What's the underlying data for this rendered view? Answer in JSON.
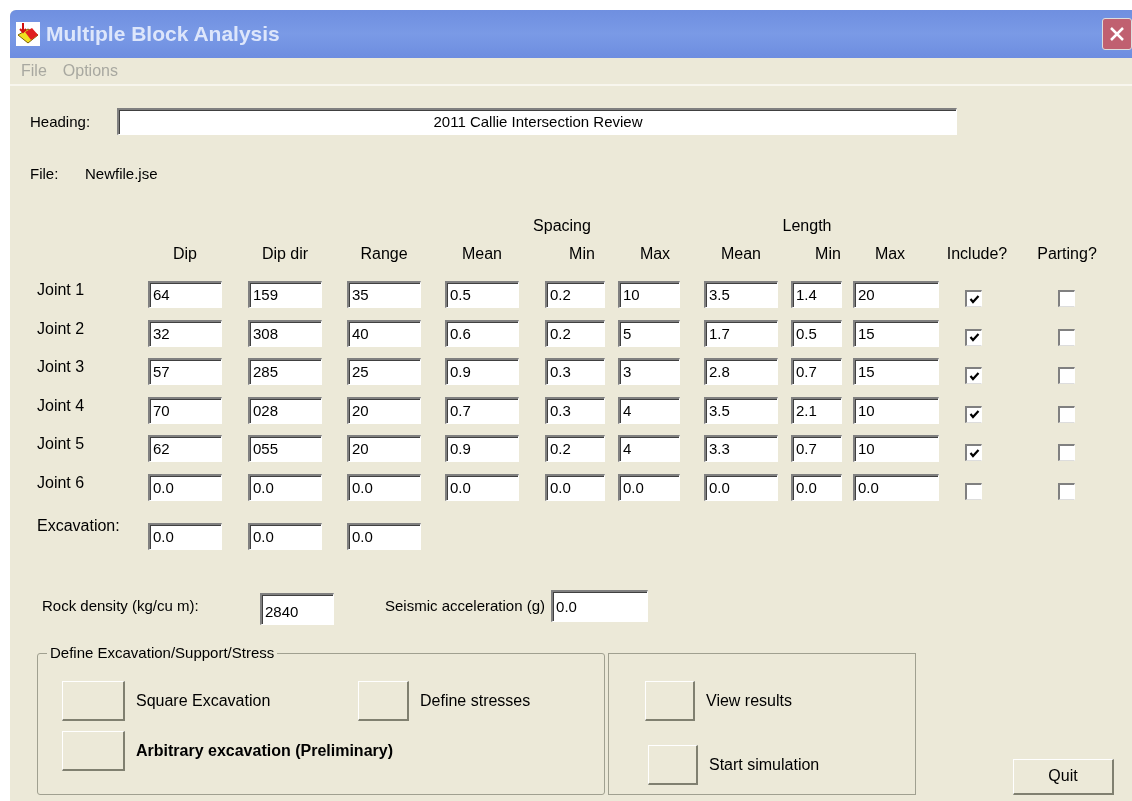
{
  "window": {
    "title": "Multiple Block Analysis"
  },
  "menu": [
    {
      "label": "File",
      "disabled": true
    },
    {
      "label": "Options",
      "disabled": true
    }
  ],
  "heading": {
    "label": "Heading:",
    "value": "2011 Callie Intersection Review"
  },
  "file": {
    "label": "File:",
    "value": "Newfile.jse"
  },
  "group_headers": [
    "Spacing",
    "Length"
  ],
  "columns": [
    "Dip",
    "Dip dir",
    "Range",
    "Mean",
    "Min",
    "Max",
    "Mean",
    "Min",
    "Max",
    "Include?",
    "Parting?"
  ],
  "joints": [
    {
      "label": "Joint 1",
      "values": [
        "64",
        "159",
        "35",
        "0.5",
        "0.2",
        "10",
        "3.5",
        "1.4",
        "20"
      ],
      "include": true,
      "parting": false
    },
    {
      "label": "Joint 2",
      "values": [
        "32",
        "308",
        "40",
        "0.6",
        "0.2",
        "5",
        "1.7",
        "0.5",
        "15"
      ],
      "include": true,
      "parting": false
    },
    {
      "label": "Joint 3",
      "values": [
        "57",
        "285",
        "25",
        "0.9",
        "0.3",
        "3",
        "2.8",
        "0.7",
        "15"
      ],
      "include": true,
      "parting": false
    },
    {
      "label": "Joint 4",
      "values": [
        "70",
        "028",
        "20",
        "0.7",
        "0.3",
        "4",
        "3.5",
        "2.1",
        "10"
      ],
      "include": true,
      "parting": false
    },
    {
      "label": "Joint 5",
      "values": [
        "62",
        "055",
        "20",
        "0.9",
        "0.2",
        "4",
        "3.3",
        "0.7",
        "10"
      ],
      "include": true,
      "parting": false
    },
    {
      "label": "Joint 6",
      "values": [
        "0.0",
        "0.0",
        "0.0",
        "0.0",
        "0.0",
        "0.0",
        "0.0",
        "0.0",
        "0.0"
      ],
      "include": false,
      "parting": false
    }
  ],
  "excavation": {
    "label": "Excavation:",
    "values": [
      "0.0",
      "0.0",
      "0.0"
    ]
  },
  "rock_density": {
    "label": "Rock density (kg/cu m):",
    "value": "2840"
  },
  "seismic": {
    "label": "Seismic acceleration (g)",
    "value": "0.0"
  },
  "define_group": {
    "title": "Define Excavation/Support/Stress",
    "options": [
      {
        "label": "Square Excavation",
        "bold": false
      },
      {
        "label": "Define stresses",
        "bold": false
      },
      {
        "label": "Arbitrary excavation (Preliminary)",
        "bold": true
      }
    ]
  },
  "actions": [
    {
      "label": "View results"
    },
    {
      "label": "Start simulation"
    }
  ],
  "quit": "Quit"
}
